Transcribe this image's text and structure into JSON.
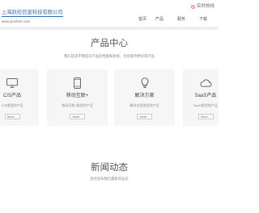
{
  "header": {
    "company_name": "上海跃控信息科技有限公司",
    "website": "www.poshee.com",
    "hotline_icon": "phone-icon",
    "hotline_label": "实时热线",
    "nav": [
      {
        "label": "首页"
      },
      {
        "label": "产品"
      },
      {
        "label": "服务"
      },
      {
        "label": "下载"
      }
    ]
  },
  "products": {
    "title": "产品中心",
    "subtitle": "我们追求不断提升产品的性能和体验，为您提供更好的产品",
    "cards": [
      {
        "icon": "monitor-icon",
        "title": "C/S产品",
        "desc": "C/S类型的产品",
        "more": "More..."
      },
      {
        "icon": "mobile-phone-icon",
        "title": "移动互联+",
        "desc": "移动互联+类型的产品",
        "more": "More..."
      },
      {
        "icon": "light-bulb-icon",
        "title": "解决方案",
        "desc": "解决方案类型的产品",
        "more": "More..."
      },
      {
        "icon": "cloud-icon",
        "title": "SaaS产品",
        "desc": "SaaS类型的产品",
        "more": "More..."
      }
    ]
  },
  "news": {
    "title": "新闻动态",
    "subtitle": "及时发布我们最新的动态"
  },
  "colors": {
    "brand": "#2f6db5",
    "card_background": "#f6f6f6",
    "divider": "#eeeeee",
    "hotline_accent": "#d9534f"
  }
}
